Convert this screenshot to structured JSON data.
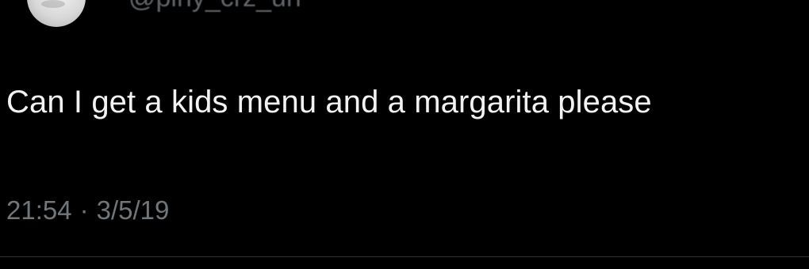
{
  "author": {
    "handle": "@piny_crz_uh",
    "avatar_icon": "profile-avatar"
  },
  "tweet": {
    "text": "Can I get a kids menu and a margarita please",
    "time": "21:54",
    "separator": "·",
    "date": "3/5/19"
  },
  "colors": {
    "background": "#000000",
    "text": "#f2f2f2",
    "muted": "#71767b",
    "divider": "#2f3336"
  }
}
